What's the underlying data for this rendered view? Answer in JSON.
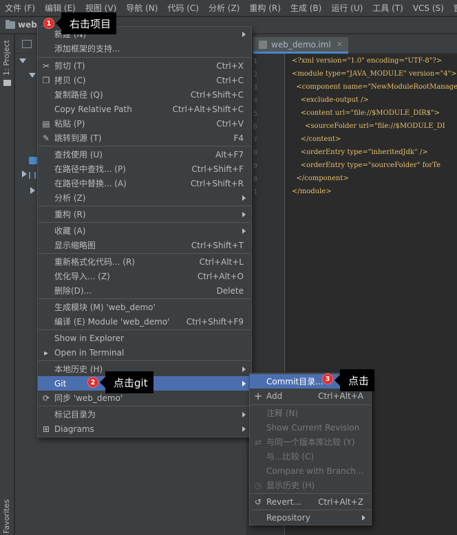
{
  "menubar": {
    "items": [
      "文件 (F)",
      "编辑 (E)",
      "视图 (V)",
      "导航 (N)",
      "代码 (C)",
      "分析 (Z)",
      "重构 (R)",
      "生成 (B)",
      "运行 (U)",
      "工具 (T)",
      "VCS (S)",
      "窗口 ("
    ]
  },
  "navbar": {
    "project": "web"
  },
  "toolwindows": {
    "project": "1: Project",
    "favorites": "Favorites"
  },
  "editor": {
    "tab_label": "web_demo.iml",
    "line_numbers": [
      "1",
      "2",
      "3",
      "4",
      "5",
      "6",
      "7",
      "8",
      "9",
      "0",
      "1"
    ],
    "lines": [
      "<?xml version=\"1.0\" encoding=\"UTF-8\"?>",
      "<module type=\"JAVA_MODULE\" version=\"4\">",
      "  <component name=\"NewModuleRootManager\"",
      "    <exclude-output />",
      "    <content url=\"file://$MODULE_DIR$\">",
      "      <sourceFolder url=\"file://$MODULE_DI",
      "    </content>",
      "    <orderEntry type=\"inheritedJdk\" />",
      "    <orderEntry type=\"sourceFolder\" forTe",
      "  </component>",
      "</module>"
    ]
  },
  "context_menu": {
    "items": [
      {
        "label": "新建 (N)",
        "shortcut": "",
        "submenu": true,
        "icon": ""
      },
      {
        "label": "添加框架的支持...",
        "shortcut": "",
        "submenu": false,
        "icon": ""
      },
      {
        "label": "剪切 (T)",
        "shortcut": "Ctrl+X",
        "submenu": false,
        "icon": "scissors-icon"
      },
      {
        "label": "拷贝 (C)",
        "shortcut": "Ctrl+C",
        "submenu": false,
        "icon": "copy-icon"
      },
      {
        "label": "复制路径 (Q)",
        "shortcut": "Ctrl+Shift+C",
        "submenu": false,
        "icon": ""
      },
      {
        "label": "Copy Relative Path",
        "shortcut": "Ctrl+Alt+Shift+C",
        "submenu": false,
        "icon": ""
      },
      {
        "label": "粘贴 (P)",
        "shortcut": "Ctrl+V",
        "submenu": false,
        "icon": "paste-icon"
      },
      {
        "label": "跳转到源 (T)",
        "shortcut": "F4",
        "submenu": false,
        "icon": "pencil-icon"
      },
      {
        "label": "查找使用 (U)",
        "shortcut": "Alt+F7",
        "submenu": false,
        "icon": ""
      },
      {
        "label": "在路径中查找... (P)",
        "shortcut": "Ctrl+Shift+F",
        "submenu": false,
        "icon": ""
      },
      {
        "label": "在路径中替换... (A)",
        "shortcut": "Ctrl+Shift+R",
        "submenu": false,
        "icon": ""
      },
      {
        "label": "分析 (Z)",
        "shortcut": "",
        "submenu": true,
        "icon": ""
      },
      {
        "label": "重构 (R)",
        "shortcut": "",
        "submenu": true,
        "icon": ""
      },
      {
        "label": "收藏 (A)",
        "shortcut": "",
        "submenu": true,
        "icon": ""
      },
      {
        "label": "显示缩略图",
        "shortcut": "Ctrl+Shift+T",
        "submenu": false,
        "icon": ""
      },
      {
        "label": "重新格式化代码... (R)",
        "shortcut": "Ctrl+Alt+L",
        "submenu": false,
        "icon": ""
      },
      {
        "label": "优化导入... (Z)",
        "shortcut": "Ctrl+Alt+O",
        "submenu": false,
        "icon": ""
      },
      {
        "label": "删除(D)...",
        "shortcut": "Delete",
        "submenu": false,
        "icon": ""
      },
      {
        "label": "生成模块 (M) 'web_demo'",
        "shortcut": "",
        "submenu": false,
        "icon": ""
      },
      {
        "label": "编译 (E) Module 'web_demo'",
        "shortcut": "Ctrl+Shift+F9",
        "submenu": false,
        "icon": ""
      },
      {
        "label": "Show in Explorer",
        "shortcut": "",
        "submenu": false,
        "icon": ""
      },
      {
        "label": "Open in Terminal",
        "shortcut": "",
        "submenu": false,
        "icon": "terminal-icon"
      },
      {
        "label": "本地历史 (H)",
        "shortcut": "",
        "submenu": true,
        "icon": ""
      },
      {
        "label": "Git",
        "shortcut": "",
        "submenu": true,
        "icon": "",
        "highlighted": true
      },
      {
        "label": "同步 'web_demo'",
        "shortcut": "",
        "submenu": false,
        "icon": "sync-icon"
      },
      {
        "label": "标记目录为",
        "shortcut": "",
        "submenu": true,
        "icon": ""
      },
      {
        "label": "Diagrams",
        "shortcut": "",
        "submenu": true,
        "icon": "diagram-icon"
      }
    ]
  },
  "git_menu": {
    "items": [
      {
        "label": "Commit目录...",
        "shortcut": "",
        "disabled": false,
        "submenu": false,
        "icon": "",
        "highlighted": true
      },
      {
        "label": "Add",
        "shortcut": "Ctrl+Alt+A",
        "disabled": false,
        "submenu": false,
        "icon": "plus-icon"
      },
      {
        "label": "注释 (N)",
        "shortcut": "",
        "disabled": true,
        "submenu": false,
        "icon": ""
      },
      {
        "label": "Show Current Revision",
        "shortcut": "",
        "disabled": true,
        "submenu": false,
        "icon": ""
      },
      {
        "label": "与同一个版本库比较 (Y)",
        "shortcut": "",
        "disabled": true,
        "submenu": false,
        "icon": "compare-icon"
      },
      {
        "label": "与...比较 (C)",
        "shortcut": "",
        "disabled": true,
        "submenu": false,
        "icon": ""
      },
      {
        "label": "Compare with Branch...",
        "shortcut": "",
        "disabled": true,
        "submenu": false,
        "icon": ""
      },
      {
        "label": "显示历史 (H)",
        "shortcut": "",
        "disabled": true,
        "submenu": false,
        "icon": "clock-icon"
      },
      {
        "label": "Revert...",
        "shortcut": "Ctrl+Alt+Z",
        "disabled": false,
        "submenu": false,
        "icon": "revert-icon"
      },
      {
        "label": "Repository",
        "shortcut": "",
        "disabled": false,
        "submenu": true,
        "icon": ""
      }
    ]
  },
  "annotations": [
    {
      "number": "1",
      "text": "右击项目"
    },
    {
      "number": "2",
      "text": "点击git"
    },
    {
      "number": "3",
      "text": "点击"
    }
  ],
  "colors": {
    "menu_bg": "#3c3f41",
    "highlight": "#4b6eaf",
    "badge": "#e02c2c",
    "callout_bg": "#000000"
  }
}
